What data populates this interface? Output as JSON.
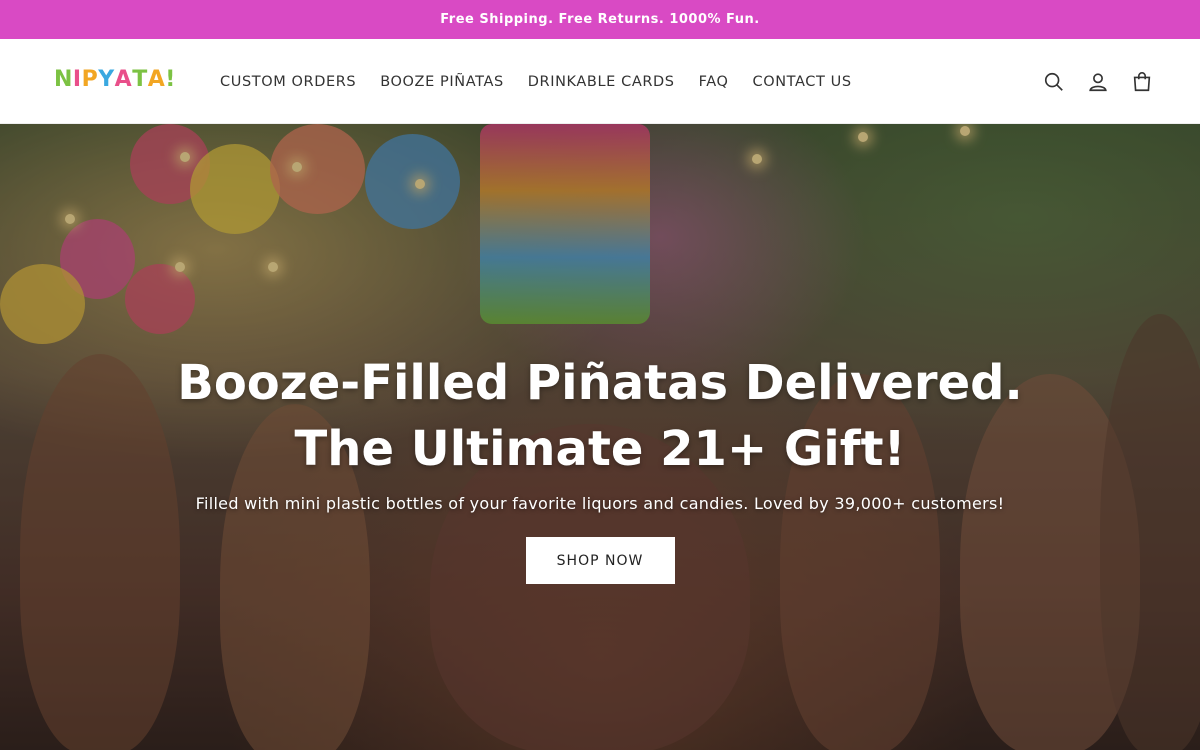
{
  "announcement": {
    "text": "Free Shipping. Free Returns. 1000% Fun."
  },
  "brand": {
    "logo_letters": [
      "N",
      "I",
      "P",
      "Y",
      "A",
      "T",
      "A",
      "!"
    ],
    "logo_colors": [
      "#7cc243",
      "#e94f8a",
      "#f2a623",
      "#3aa8e0",
      "#e94f8a",
      "#7cc243",
      "#f2a623",
      "#7cc243"
    ]
  },
  "nav": {
    "items": [
      {
        "label": "CUSTOM ORDERS"
      },
      {
        "label": "BOOZE PIÑATAS"
      },
      {
        "label": "DRINKABLE CARDS"
      },
      {
        "label": "FAQ"
      },
      {
        "label": "CONTACT US"
      }
    ]
  },
  "header_icons": [
    "search-icon",
    "account-icon",
    "cart-icon"
  ],
  "hero": {
    "title": "Booze-Filled Piñatas Delivered. The Ultimate 21+ Gift!",
    "subtitle": "Filled with mini plastic bottles of your favorite liquors and candies. Loved by 39,000+ customers!",
    "cta_label": "SHOP NOW"
  },
  "colors": {
    "announcement_bg": "#d94ac4",
    "cta_bg": "#ffffff"
  }
}
